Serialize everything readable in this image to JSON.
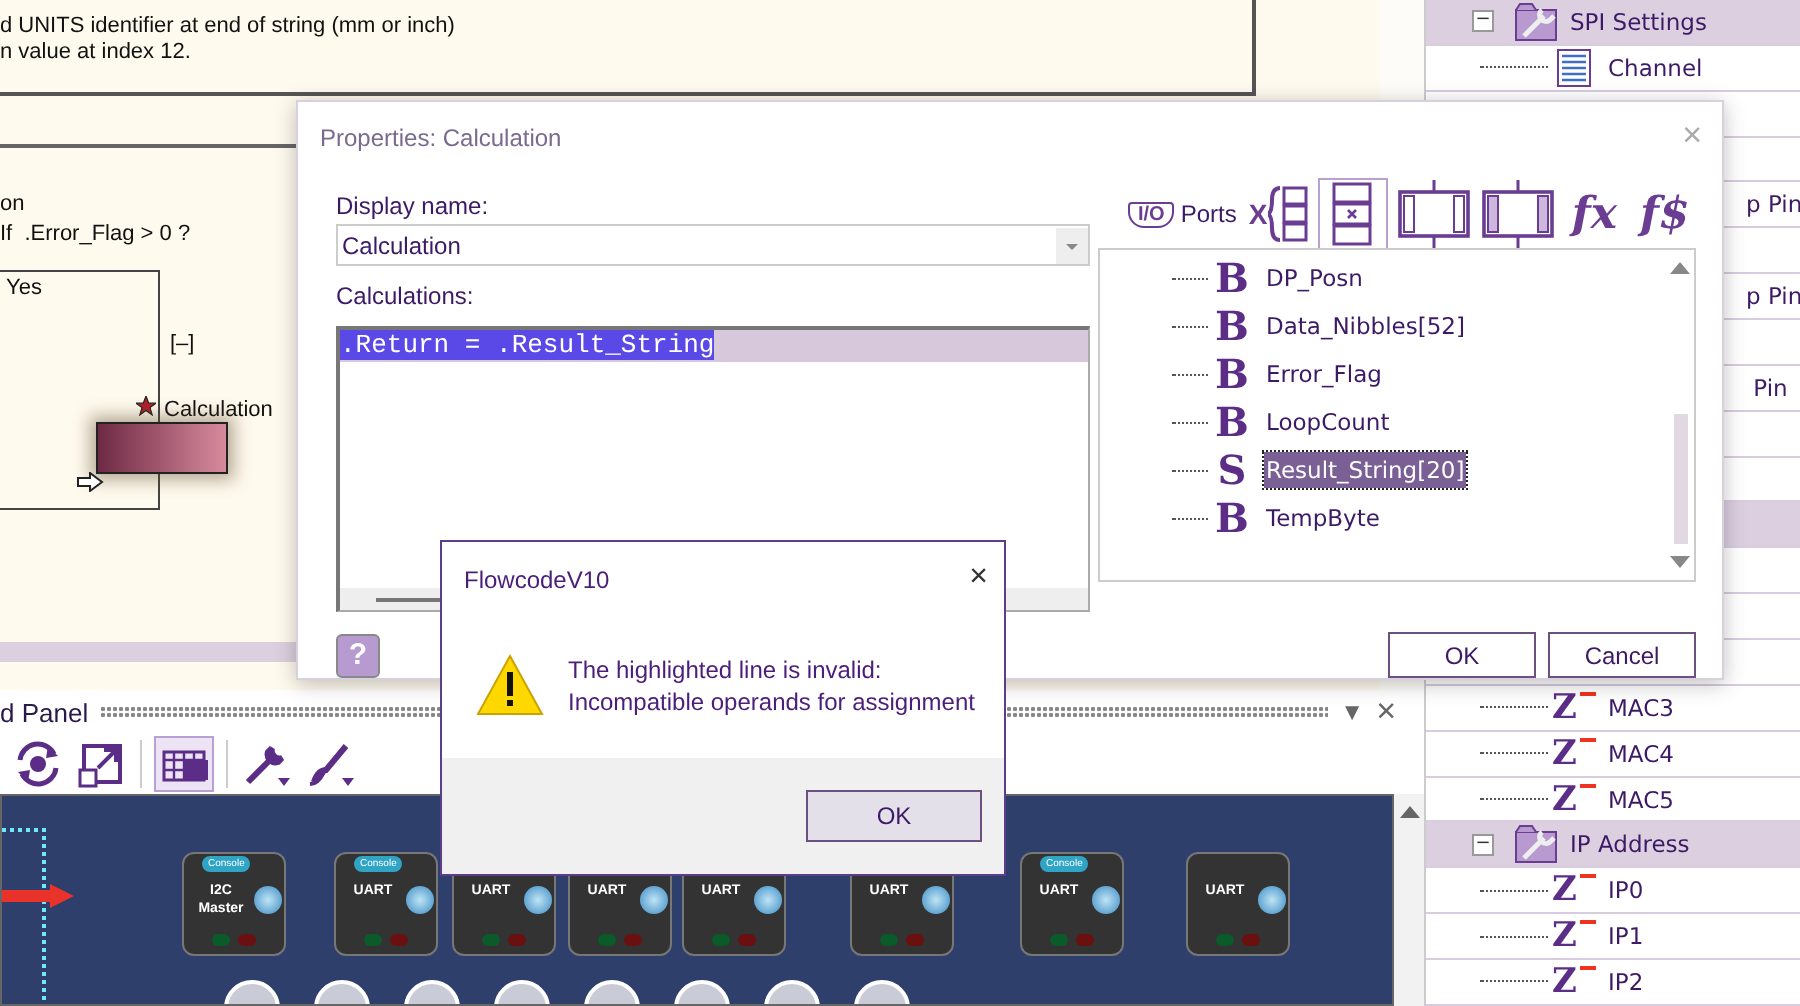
{
  "flowchart": {
    "description_lines": [
      "d UNITS identifier at end of string (mm or inch)",
      "n value at index 12."
    ],
    "decision_lines": [
      "on",
      "If  .Error_Flag > 0 ?"
    ],
    "branch_label": "Yes",
    "collapse_label": "[–]",
    "icon_label": "Calculation",
    "bookmarked": true
  },
  "dashboard": {
    "title": "d Panel",
    "menu_glyph": "▼",
    "close_glyph": "×",
    "tools": [
      {
        "kind": "rotate",
        "selected": false
      },
      {
        "kind": "expand",
        "selected": false
      },
      {
        "kind": "grid",
        "selected": true
      },
      {
        "kind": "wrench",
        "selected": false
      },
      {
        "kind": "brush",
        "selected": false
      }
    ],
    "components": [
      {
        "badge": "Console",
        "title_lines": [
          "I2C",
          "Master"
        ]
      },
      {
        "badge": "Console",
        "title_lines": [
          "UART"
        ]
      },
      {
        "title_lines": [
          "UART"
        ]
      },
      {
        "title_lines": [
          "UART"
        ]
      },
      {
        "title_lines": [
          "UART"
        ]
      },
      {
        "title_lines": [
          "UART"
        ]
      },
      {
        "badge": "Console",
        "title_lines": [
          "UART"
        ]
      },
      {
        "title_lines": [
          "UART"
        ]
      }
    ]
  },
  "project_tree": [
    {
      "kind": "group",
      "toggle": "−",
      "text": "SPI Settings"
    },
    {
      "kind": "doc",
      "text": "Channel"
    },
    {
      "kind": "blank"
    },
    {
      "kind": "blank"
    },
    {
      "kind": "clipped",
      "text": "p Pin"
    },
    {
      "kind": "blank"
    },
    {
      "kind": "clipped",
      "text": "p Pin"
    },
    {
      "kind": "blank"
    },
    {
      "kind": "clipped",
      "text": " Pin"
    },
    {
      "kind": "blank"
    },
    {
      "kind": "blank"
    },
    {
      "kind": "blank-group"
    },
    {
      "kind": "blank"
    },
    {
      "kind": "blank"
    },
    {
      "kind": "blank"
    },
    {
      "kind": "var",
      "glyph": "Z",
      "text": "MAC3"
    },
    {
      "kind": "var",
      "glyph": "Z",
      "text": "MAC4"
    },
    {
      "kind": "var",
      "glyph": "Z",
      "text": "MAC5"
    },
    {
      "kind": "group",
      "toggle": "−",
      "text": "IP Address"
    },
    {
      "kind": "var",
      "glyph": "Z",
      "text": "IP0"
    },
    {
      "kind": "var",
      "glyph": "Z",
      "text": "IP1"
    },
    {
      "kind": "var",
      "glyph": "Z",
      "text": "IP2"
    }
  ],
  "properties_dialog": {
    "title": "Properties: Calculation",
    "close_glyph": "×",
    "display_name_label": "Display name:",
    "display_name": "Calculation",
    "calculations_label": "Calculations:",
    "calculations": [
      {
        "text": ".Return = .Result_String",
        "selected": true
      }
    ],
    "toolbar": [
      {
        "kind": "io",
        "glyph": "I/O",
        "label": "Ports",
        "selected": false
      },
      {
        "kind": "xbrace",
        "glyph": "X",
        "selected": false
      },
      {
        "kind": "boxx",
        "selected": true
      },
      {
        "kind": "box",
        "selected": false
      },
      {
        "kind": "boxhatch",
        "selected": false
      },
      {
        "kind": "fn",
        "glyph": "fx",
        "selected": false
      },
      {
        "kind": "fn",
        "glyph": "f$",
        "selected": false
      }
    ],
    "variables": [
      {
        "glyph": "B",
        "name": "DP_Posn",
        "selected": false
      },
      {
        "glyph": "B",
        "name": "Data_Nibbles[52]",
        "selected": false
      },
      {
        "glyph": "B",
        "name": "Error_Flag",
        "selected": false
      },
      {
        "glyph": "B",
        "name": "LoopCount",
        "selected": false
      },
      {
        "glyph": "S",
        "name": "Result_String[20]",
        "selected": true
      },
      {
        "glyph": "B",
        "name": "TempByte",
        "selected": false
      }
    ],
    "help_glyph": "?",
    "buttons": [
      "OK",
      "Cancel"
    ]
  },
  "message_box": {
    "title": "FlowcodeV10",
    "close_glyph": "×",
    "lines": [
      "The highlighted line is invalid:",
      "Incompatible operands for assignment"
    ],
    "button": "OK"
  }
}
